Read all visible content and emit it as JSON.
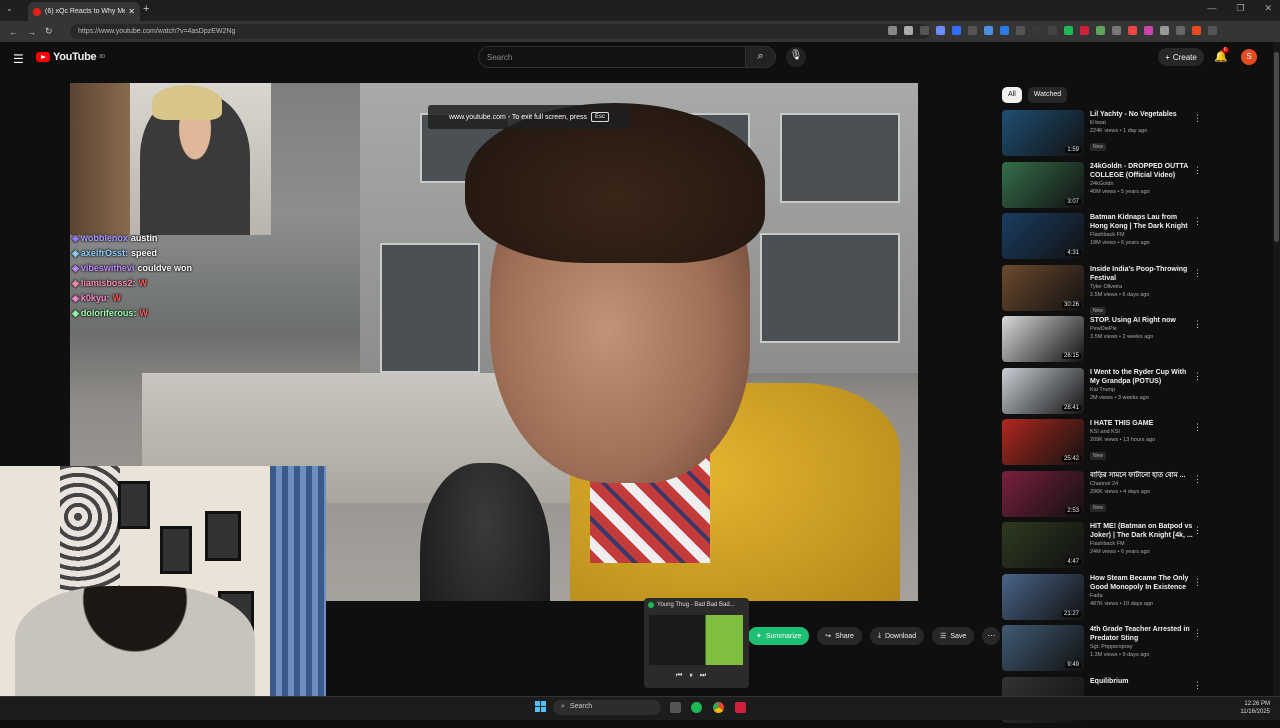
{
  "browser": {
    "tab_title": "(6) xQc Reacts to Why Men and",
    "url": "https://www.youtube.com/watch?v=4asDpzEW2Ng"
  },
  "youtube": {
    "logo_text": "YouTube",
    "logo_sup": "80",
    "search_placeholder": "Search",
    "create_label": "Create",
    "notif_count": "6",
    "avatar_letter": "S"
  },
  "player": {
    "fullscreen_msg": "www.youtube.com - To exit full screen, press",
    "esc_key": "Esc"
  },
  "chat": [
    {
      "user": "wobblenox",
      "msg": "austin",
      "color": "#b49bff"
    },
    {
      "user": "axelfrOsst:",
      "msg": "speed",
      "color": "#8fd3ff"
    },
    {
      "user": "vibeswithevi",
      "msg": "couldve won",
      "color": "#c58cff"
    },
    {
      "user": "liamisboss2:",
      "msg": "W",
      "color": "#ff8fb4"
    },
    {
      "user": "k0kyu:",
      "msg": "W",
      "color": "#ff8cd1"
    },
    {
      "user": "doloriferous:",
      "msg": "W",
      "color": "#9bffb0"
    }
  ],
  "actions": {
    "summarize": "Summarize",
    "share": "Share",
    "download": "Download",
    "save": "Save"
  },
  "spotify_preview": {
    "title": "Young Thug - Bad Bad Bad..."
  },
  "sidebar": {
    "chips": [
      "All",
      "Watched"
    ],
    "recs": [
      {
        "title": "Lil Yachty - No Vegetables",
        "channel": "lil boat",
        "meta": "224K views • 1 day ago",
        "duration": "1:59",
        "new": "New",
        "color": "#1f4f73"
      },
      {
        "title": "24kGoldn - DROPPED OUTTA COLLEGE (Official Video)",
        "channel": "24kGoldn",
        "meta": "40M views • 5 years ago",
        "duration": "3:07",
        "new": "",
        "color": "#356e4a"
      },
      {
        "title": "Batman Kidnaps Lau from Hong Kong | The Dark Knight [4k, ...",
        "channel": "Flashback FM",
        "meta": "18M views • 6 years ago",
        "duration": "4:31",
        "new": "",
        "color": "#1b3d62"
      },
      {
        "title": "Inside India's Poop-Throwing Festival",
        "channel": "Tyler Oliveira",
        "meta": "2.5M views • 6 days ago",
        "duration": "30:26",
        "new": "New",
        "color": "#6d4a2e"
      },
      {
        "title": "STOP. Using AI Right now",
        "channel": "PewDiePie",
        "meta": "3.5M views • 2 weeks ago",
        "duration": "26:15",
        "new": "",
        "color": "#d9d9d9"
      },
      {
        "title": "I Went to the Ryder Cup With My Grandpa (POTUS)",
        "channel": "Kai Trump",
        "meta": "2M views • 3 weeks ago",
        "duration": "28:41",
        "new": "",
        "color": "#c9cfd6"
      },
      {
        "title": "I HATE THIS GAME",
        "channel": "KSI and KSI",
        "meta": "209K views • 13 hours ago",
        "duration": "25:42",
        "new": "New",
        "color": "#b0281f"
      },
      {
        "title": "বাড়ির সামনে ফাটানো হাত বোম ...",
        "channel": "Channel 24",
        "meta": "296K views • 4 days ago",
        "duration": "2:53",
        "new": "New",
        "color": "#7a1f3d"
      },
      {
        "title": "HIT ME! (Batman on Batpod vs Joker) | The Dark Knight [4k, ...",
        "channel": "Flashback FM",
        "meta": "24M views • 6 years ago",
        "duration": "4:47",
        "new": "",
        "color": "#2d3a1f"
      },
      {
        "title": "How Steam Became The Only Good Monopoly In Existence",
        "channel": "Fada",
        "meta": "487K views • 10 days ago",
        "duration": "21:27",
        "new": "",
        "color": "#4a6488"
      },
      {
        "title": "4th Grade Teacher Arrested in Predator Sting",
        "channel": "Sgt. Pepperspray",
        "meta": "1.3M views • 9 days ago",
        "duration": "9:49",
        "new": "",
        "color": "#3f5b73"
      },
      {
        "title": "Equilibrium",
        "channel": "",
        "meta": "",
        "duration": "",
        "new": "",
        "color": "#333333"
      }
    ]
  },
  "taskbar": {
    "search": "Search",
    "time": "12:26 PM",
    "date": "11/16/2025"
  }
}
